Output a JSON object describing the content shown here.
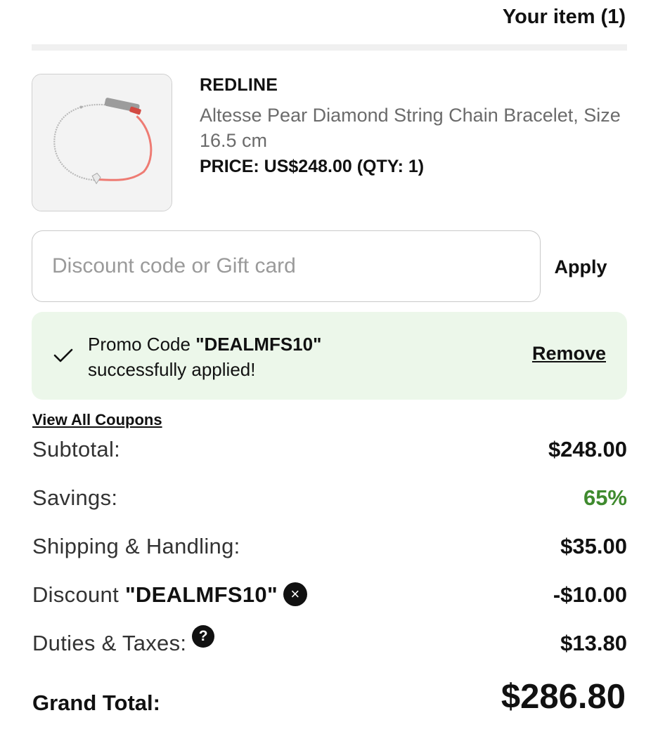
{
  "header": {
    "title": "Your item (1)"
  },
  "product": {
    "image_icon": "bracelet-image",
    "brand": "REDLINE",
    "name": "Altesse Pear Diamond String Chain Bracelet, Size 16.5 cm",
    "price_line": "PRICE: US$248.00 (QTY: 1)"
  },
  "discount": {
    "placeholder": "Discount code or Gift card",
    "value": "",
    "apply_label": "Apply"
  },
  "promo": {
    "icon": "check-icon",
    "prefix": "Promo Code ",
    "code": "\"DEALMFS10\"",
    "suffix": "successfully applied!",
    "remove_label": "Remove",
    "background_color": "#ecf7ea"
  },
  "coupons": {
    "view_all_label": "View All Coupons"
  },
  "summary": {
    "subtotal": {
      "label": "Subtotal:",
      "value": "$248.00"
    },
    "savings": {
      "label": "Savings:",
      "value": "65%",
      "color": "#3f8a2e"
    },
    "shipping": {
      "label": "Shipping & Handling:",
      "value": "$35.00"
    },
    "discount": {
      "label_prefix": "Discount ",
      "label_code": "\"DEALMFS10\"",
      "remove_icon": "close-circle-icon",
      "remove_glyph": "×",
      "value": "-$10.00"
    },
    "duties": {
      "label": "Duties & Taxes:",
      "help_icon": "question-circle-icon",
      "help_glyph": "?",
      "value": "$13.80"
    },
    "grand_total": {
      "label": "Grand Total:",
      "value": "$286.80"
    }
  }
}
